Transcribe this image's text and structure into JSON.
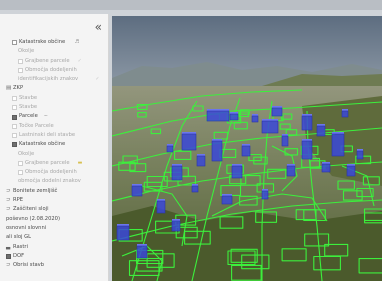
{
  "panel": {
    "collapse_icon": "double-chevron-left",
    "rows": [
      {
        "indent": 1,
        "box": "unchecked",
        "icon": "",
        "label": "Katastrske občine",
        "tail": "♬",
        "dim": false
      },
      {
        "indent": 2,
        "box": "none",
        "icon": "",
        "label": "Okolje",
        "tail": "",
        "dim": true
      },
      {
        "indent": 2,
        "box": "unchecked",
        "icon": "",
        "label": "Grajbene parcele",
        "tail": "✓",
        "dim": true
      },
      {
        "indent": 2,
        "box": "unchecked",
        "icon": "",
        "label": "Območja dodeljenih",
        "tail": "",
        "dim": true
      },
      {
        "indent": 2,
        "box": "none",
        "icon": "",
        "label": "identifikacijskih znakov",
        "tail": "✓",
        "dim": true
      },
      {
        "indent": 0,
        "box": "none",
        "icon": "▤",
        "label": "ZKP",
        "tail": "",
        "dim": false
      },
      {
        "indent": 1,
        "box": "unchecked",
        "icon": "",
        "label": "Stavbe",
        "tail": "",
        "dim": true
      },
      {
        "indent": 1,
        "box": "unchecked",
        "icon": "",
        "label": "Stavbe",
        "tail": "",
        "dim": true
      },
      {
        "indent": 1,
        "box": "checked",
        "icon": "",
        "label": "Parcele",
        "tail": "∼",
        "dim": false
      },
      {
        "indent": 1,
        "box": "unchecked",
        "icon": "",
        "label": "Točke Parcele",
        "tail": "",
        "dim": true
      },
      {
        "indent": 1,
        "box": "unchecked",
        "icon": "",
        "label": "Lastninski deli stavbe",
        "tail": "",
        "dim": true
      },
      {
        "indent": 1,
        "box": "checked",
        "icon": "",
        "label": "Katastrske občine",
        "tail": "",
        "dim": false
      },
      {
        "indent": 2,
        "box": "none",
        "icon": "",
        "label": "Okolje",
        "tail": "",
        "dim": true
      },
      {
        "indent": 2,
        "box": "unchecked",
        "icon": "",
        "label": "Grajbene parcele",
        "tail": "▬",
        "tail_color": "yellow",
        "dim": true
      },
      {
        "indent": 2,
        "box": "unchecked",
        "icon": "",
        "label": "Območja dodeljenih",
        "tail": "",
        "dim": true
      },
      {
        "indent": 2,
        "box": "none",
        "icon": "",
        "label": "območja dodelni znakov",
        "tail": "",
        "dim": true
      },
      {
        "indent": 0,
        "box": "none",
        "icon": "⊃",
        "label": "Bonitete zemljišč",
        "tail": "",
        "dim": false
      },
      {
        "indent": 0,
        "box": "none",
        "icon": "⊃",
        "label": "RPE",
        "tail": "",
        "dim": false
      },
      {
        "indent": 0,
        "box": "none",
        "icon": "⊃",
        "label": "Zaščiteni sloji",
        "tail": "",
        "dim": false
      },
      {
        "indent": 0,
        "box": "none",
        "icon": "",
        "label": "poševno (2.08.2020)",
        "tail": "",
        "dim": false
      },
      {
        "indent": 0,
        "box": "none",
        "icon": "",
        "label": "osnovni slovnni",
        "tail": "",
        "dim": false
      },
      {
        "indent": 0,
        "box": "none",
        "icon": "",
        "label": "ali sloj GL",
        "tail": "",
        "dim": false
      },
      {
        "indent": 0,
        "box": "none",
        "icon": "▃",
        "label": "Rastri",
        "tail": "",
        "dim": false
      },
      {
        "indent": 0,
        "box": "checked",
        "icon": "",
        "label": "DOF",
        "tail": "",
        "dim": false
      },
      {
        "indent": 0,
        "box": "none",
        "icon": "⊃",
        "label": "Obrisi stavb",
        "tail": "",
        "dim": false
      }
    ]
  },
  "colors": {
    "panel_bg": "#f4f4f4",
    "parcel_lines": "#3cf03c",
    "buildings": "#3a48d8",
    "sky": "#6d7f93"
  }
}
